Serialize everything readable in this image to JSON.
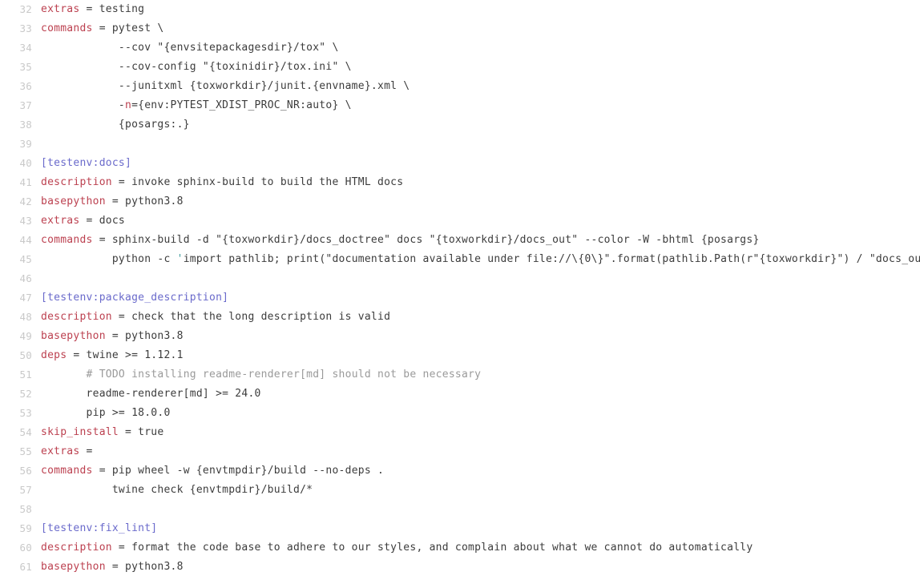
{
  "view": {
    "name": "source-code-viewer",
    "language": "ini",
    "background": "#ffffff",
    "first_line_number": 32,
    "last_line_number": 61,
    "colors": {
      "key": "#bc4150",
      "section": "#6a6acb",
      "comment": "#9a9a9a",
      "text": "#3c3c3c",
      "gutter": "#c9c9c9",
      "background": "#ffffff",
      "teal": "#3f9c9c"
    }
  },
  "lines": [
    {
      "number": "32",
      "spans": [
        {
          "t": "extras",
          "c": "tok-key"
        },
        {
          "t": " = testing",
          "c": "tok-text"
        }
      ]
    },
    {
      "number": "33",
      "spans": [
        {
          "t": "commands",
          "c": "tok-key"
        },
        {
          "t": " = pytest \\",
          "c": "tok-text"
        }
      ]
    },
    {
      "number": "34",
      "spans": [
        {
          "t": "            --cov \"{envsitepackagesdir}/tox\" \\",
          "c": "tok-text"
        }
      ]
    },
    {
      "number": "35",
      "spans": [
        {
          "t": "            --cov-config \"{toxinidir}/tox.ini\" \\",
          "c": "tok-text"
        }
      ]
    },
    {
      "number": "36",
      "spans": [
        {
          "t": "            --junitxml {toxworkdir}/junit.{envname}.xml \\",
          "c": "tok-text"
        }
      ]
    },
    {
      "number": "37",
      "spans": [
        {
          "t": "            -",
          "c": "tok-text"
        },
        {
          "t": "n",
          "c": "tok-key"
        },
        {
          "t": "={env:PYTEST_XDIST_PROC_NR:auto} \\",
          "c": "tok-text"
        }
      ]
    },
    {
      "number": "38",
      "spans": [
        {
          "t": "            {posargs:.}",
          "c": "tok-text"
        }
      ]
    },
    {
      "number": "39",
      "spans": [
        {
          "t": "",
          "c": "tok-text"
        }
      ]
    },
    {
      "number": "40",
      "spans": [
        {
          "t": "[testenv:docs]",
          "c": "tok-section"
        }
      ]
    },
    {
      "number": "41",
      "spans": [
        {
          "t": "description",
          "c": "tok-key"
        },
        {
          "t": " = invoke sphinx-build to build the HTML docs",
          "c": "tok-text"
        }
      ]
    },
    {
      "number": "42",
      "spans": [
        {
          "t": "basepython",
          "c": "tok-key"
        },
        {
          "t": " = python3.8",
          "c": "tok-text"
        }
      ]
    },
    {
      "number": "43",
      "spans": [
        {
          "t": "extras",
          "c": "tok-key"
        },
        {
          "t": " = docs",
          "c": "tok-text"
        }
      ]
    },
    {
      "number": "44",
      "spans": [
        {
          "t": "commands",
          "c": "tok-key"
        },
        {
          "t": " = sphinx-build -d \"{toxworkdir}/docs_doctree\" docs \"{toxworkdir}/docs_out\" --color -W -bhtml {posargs}",
          "c": "tok-text"
        }
      ]
    },
    {
      "number": "45",
      "spans": [
        {
          "t": "           python -c ",
          "c": "tok-text"
        },
        {
          "t": "'",
          "c": "tok-teal"
        },
        {
          "t": "import pathlib; print(\"documentation available under file://\\{0\\}\".format(pathlib.Path(r\"{toxworkdir}\") / \"docs_out\"",
          "c": "tok-text"
        }
      ]
    },
    {
      "number": "46",
      "spans": [
        {
          "t": "",
          "c": "tok-text"
        }
      ]
    },
    {
      "number": "47",
      "spans": [
        {
          "t": "[testenv:package_description]",
          "c": "tok-section"
        }
      ]
    },
    {
      "number": "48",
      "spans": [
        {
          "t": "description",
          "c": "tok-key"
        },
        {
          "t": " = check that the long description is valid",
          "c": "tok-text"
        }
      ]
    },
    {
      "number": "49",
      "spans": [
        {
          "t": "basepython",
          "c": "tok-key"
        },
        {
          "t": " = python3.8",
          "c": "tok-text"
        }
      ]
    },
    {
      "number": "50",
      "spans": [
        {
          "t": "deps",
          "c": "tok-key"
        },
        {
          "t": " = twine >= 1.12.1",
          "c": "tok-text"
        }
      ]
    },
    {
      "number": "51",
      "spans": [
        {
          "t": "       ",
          "c": "tok-text"
        },
        {
          "t": "# TODO installing readme-renderer[md] should not be necessary",
          "c": "tok-comment"
        }
      ]
    },
    {
      "number": "52",
      "spans": [
        {
          "t": "       readme-renderer[md] >= 24.0",
          "c": "tok-text"
        }
      ]
    },
    {
      "number": "53",
      "spans": [
        {
          "t": "       pip >= 18.0.0",
          "c": "tok-text"
        }
      ]
    },
    {
      "number": "54",
      "spans": [
        {
          "t": "skip_install",
          "c": "tok-key"
        },
        {
          "t": " = true",
          "c": "tok-text"
        }
      ]
    },
    {
      "number": "55",
      "spans": [
        {
          "t": "extras",
          "c": "tok-key"
        },
        {
          "t": " =",
          "c": "tok-text"
        }
      ]
    },
    {
      "number": "56",
      "spans": [
        {
          "t": "commands",
          "c": "tok-key"
        },
        {
          "t": " = pip wheel -w {envtmpdir}/build --no-deps .",
          "c": "tok-text"
        }
      ]
    },
    {
      "number": "57",
      "spans": [
        {
          "t": "           twine check {envtmpdir}/build/*",
          "c": "tok-text"
        }
      ]
    },
    {
      "number": "58",
      "spans": [
        {
          "t": "",
          "c": "tok-text"
        }
      ]
    },
    {
      "number": "59",
      "spans": [
        {
          "t": "[testenv:fix_lint]",
          "c": "tok-section"
        }
      ]
    },
    {
      "number": "60",
      "spans": [
        {
          "t": "description",
          "c": "tok-key"
        },
        {
          "t": " = format the code base to adhere to our styles, and complain about what we cannot do automatically",
          "c": "tok-text"
        }
      ]
    },
    {
      "number": "61",
      "spans": [
        {
          "t": "basepython",
          "c": "tok-key"
        },
        {
          "t": " = python3.8",
          "c": "tok-text"
        }
      ]
    }
  ]
}
